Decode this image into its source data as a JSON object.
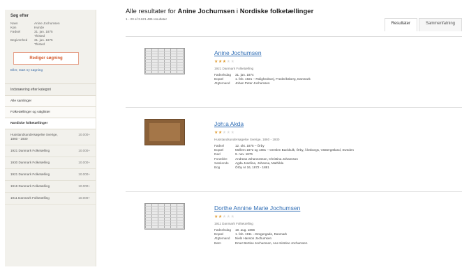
{
  "sidebar": {
    "heading": "Søg efter",
    "criteria": [
      {
        "label": "Navn",
        "value": "Anine Jochumsen"
      },
      {
        "label": "Køn",
        "value": "Kvinde"
      },
      {
        "label": "Fødsel",
        "value": "31. jan. 1875"
      },
      {
        "label": "",
        "value": "Thisted"
      },
      {
        "label": "Begivenhed",
        "value": "31. jan. 1875"
      },
      {
        "label": "",
        "value": "Thisted"
      }
    ],
    "edit_button": "Rediger søgning",
    "new_search": "Eller, start ny søgning",
    "filter_heading": "Indsnævring efter kategori",
    "tabs": [
      "Alle samlinger",
      "Folketællinger og valglister",
      "Nordiske folketællinger"
    ],
    "categories": [
      {
        "name": "Husstandsundersøgelse Sverige, 1860 - 1930",
        "count": "10.000+"
      },
      {
        "name": "1921 Danmark Folketælling",
        "count": "10.000+"
      },
      {
        "name": "1930 Danmark Folketælling",
        "count": "10.000+"
      },
      {
        "name": "1921 Danmark Folketælling",
        "count": "10.000+"
      },
      {
        "name": "1916 Danmark Folketælling",
        "count": "10.000+"
      },
      {
        "name": "1911 Danmark Folketælling",
        "count": "10.000+"
      }
    ]
  },
  "header": {
    "title_prefix": "Alle resultater for",
    "title_name": "Anine Jochumsen",
    "title_in": "i",
    "title_collection": "Nordiske folketællinger",
    "count": "1 - 20 af 3.621.486 resultater",
    "tabs": [
      "Resultater",
      "Sammenfatning"
    ]
  },
  "results": [
    {
      "name": "Anine Jochumsen",
      "stars": 3,
      "source": "1921 Danmark Folketælling",
      "thumb": "grid",
      "facts": [
        {
          "label": "Fødselsdag",
          "value": "31. jan. 1874"
        },
        {
          "label": "Bopæl",
          "value": "1. feb. 1921 – Rolighedsvej, Frederiksberg, Danmark"
        },
        {
          "label": "Ægtemand",
          "value": "Johan Peter Jochumsen"
        }
      ]
    },
    {
      "name": "Joh:a Akda",
      "stars": 2,
      "source": "Husstandsundersøgelse Sverige, 1860 - 1930",
      "thumb": "old",
      "facts": [
        {
          "label": "Fødsel",
          "value": "12. okt. 1875 – Örby"
        },
        {
          "label": "Bopæl",
          "value": "Mellem 1872 og 1881 – Greslen Backkulk, Örby, Älvsborgs, Västergötland, Sweden"
        },
        {
          "label": "Død",
          "value": "9. nov. 1876"
        },
        {
          "label": "Forældre",
          "value": "Andreas Johannesson, Christina Johansson"
        },
        {
          "label": "Søskende",
          "value": "Agda Josefina, Johanna, Mathilda"
        },
        {
          "label": "Bog",
          "value": "Örby AI 16, 1872 - 1881"
        }
      ]
    },
    {
      "name": "Dorthe Annine Marie Jochumsen",
      "stars": 2,
      "source": "1911 Danmark Folketælling",
      "thumb": "grid",
      "facts": [
        {
          "label": "Fødselsdag",
          "value": "19. aug. 1866"
        },
        {
          "label": "Bopæl",
          "value": "1. feb. 1911 – Borgergade, Danmark"
        },
        {
          "label": "Ægtemand",
          "value": "Niels Hanson Jochumsen"
        },
        {
          "label": "Børn",
          "value": "Emer Bertine Jochumsen, Ane Kirstine Jochumsen"
        }
      ]
    }
  ],
  "colors": {
    "link": "#2f6db5",
    "star": "#e09d35",
    "edit_button": "#d45b2e",
    "sidebar_bg": "#f2f1ec"
  }
}
